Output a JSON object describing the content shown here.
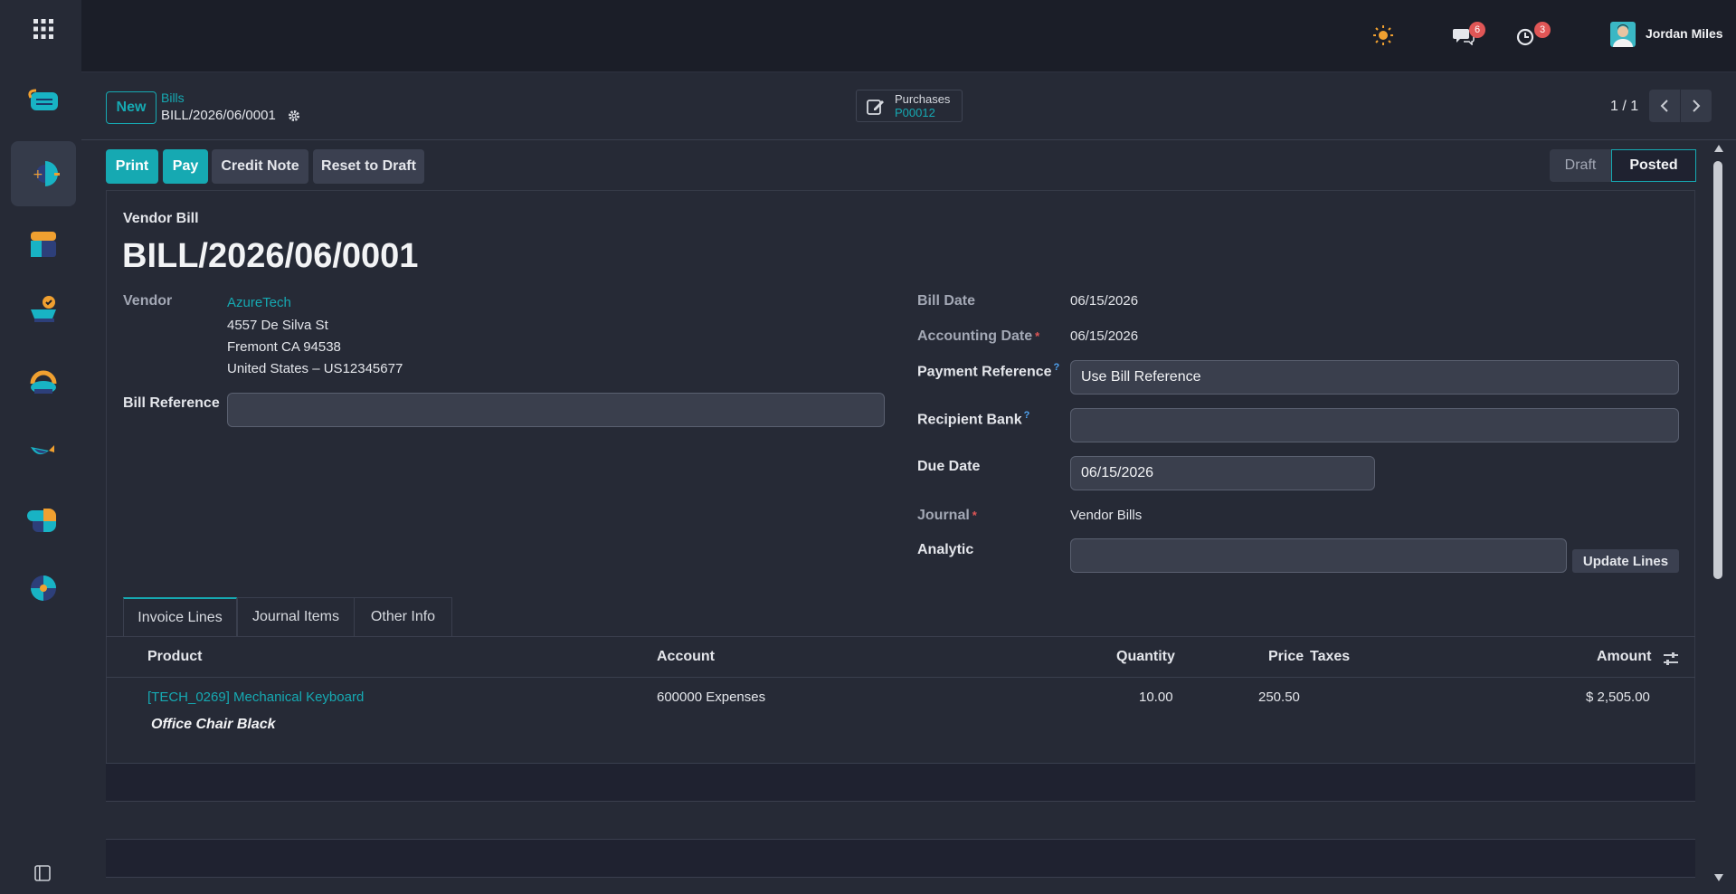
{
  "topbar": {
    "user_name": "Jordan Miles",
    "messages_count": "6",
    "activities_count": "3"
  },
  "breadcrumb": {
    "new_label": "New",
    "parent": "Bills",
    "current": "BILL/2026/06/0001"
  },
  "smart_button": {
    "label": "Purchases",
    "value": "P00012"
  },
  "pager": {
    "value": "1 / 1"
  },
  "actions": {
    "print": "Print",
    "pay": "Pay",
    "credit_note": "Credit Note",
    "reset": "Reset to Draft"
  },
  "status": {
    "draft": "Draft",
    "posted": "Posted"
  },
  "form": {
    "kind": "Vendor Bill",
    "name": "BILL/2026/06/0001",
    "vendor_label": "Vendor",
    "vendor_name": "AzureTech",
    "vendor_addr1": "4557 De Silva St",
    "vendor_addr2": "Fremont CA 94538",
    "vendor_addr3": "United States – US12345677",
    "bill_ref_label": "Bill Reference",
    "bill_ref_value": "",
    "bill_date_label": "Bill Date",
    "bill_date": "06/15/2026",
    "acc_date_label": "Accounting Date",
    "acc_date": "06/15/2026",
    "pay_ref_label": "Payment Reference",
    "pay_ref": "Use Bill Reference",
    "recipient_bank_label": "Recipient Bank",
    "recipient_bank": "",
    "due_date_label": "Due Date",
    "due_date": "06/15/2026",
    "journal_label": "Journal",
    "journal": "Vendor Bills",
    "analytic_label": "Analytic",
    "analytic": "",
    "update_lines": "Update Lines"
  },
  "tabs": [
    "Invoice Lines",
    "Journal Items",
    "Other Info"
  ],
  "table": {
    "headers": {
      "product": "Product",
      "account": "Account",
      "quantity": "Quantity",
      "price": "Price",
      "taxes": "Taxes",
      "amount": "Amount"
    },
    "rows": [
      {
        "product": "[TECH_0269] Mechanical Keyboard",
        "description": "Office Chair Black",
        "account": "600000 Expenses",
        "quantity": "10.00",
        "price": "250.50",
        "taxes": "",
        "amount": "$ 2,505.00"
      }
    ]
  },
  "colors": {
    "accent": "#16a9b2",
    "badge": "#e05656",
    "link": "#16a9b2"
  }
}
